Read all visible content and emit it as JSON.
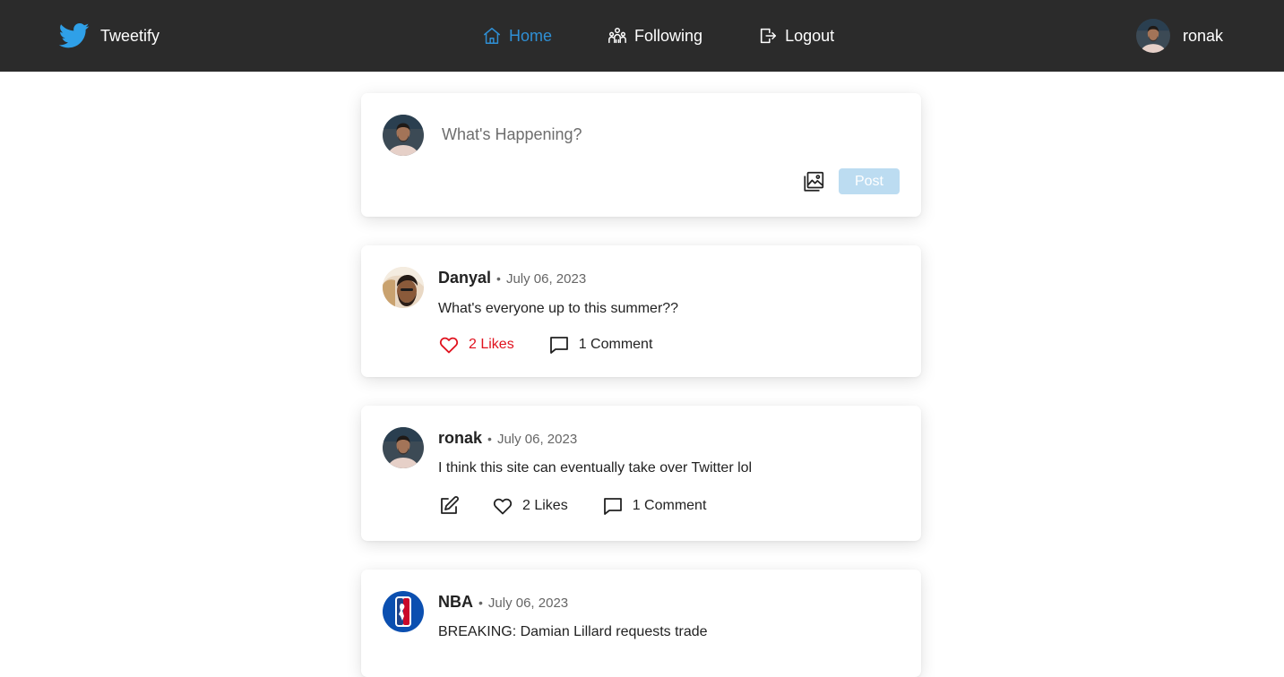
{
  "app": {
    "name": "Tweetify"
  },
  "nav": {
    "links": [
      {
        "label": "Home",
        "icon": "home-icon",
        "active": true
      },
      {
        "label": "Following",
        "icon": "following-icon",
        "active": false
      },
      {
        "label": "Logout",
        "icon": "logout-icon",
        "active": false
      }
    ],
    "user": {
      "name": "ronak"
    }
  },
  "composer": {
    "placeholder": "What's Happening?",
    "post_label": "Post",
    "media_icon": "image-gallery-icon"
  },
  "tweets": [
    {
      "author": "Danyal",
      "date": "July 06, 2023",
      "text": "What's everyone up to this summer??",
      "likes": "2 Likes",
      "comments": "1 Comment",
      "liked": true,
      "editable": false
    },
    {
      "author": "ronak",
      "date": "July 06, 2023",
      "text": "I think this site can eventually take over Twitter lol",
      "likes": "2 Likes",
      "comments": "1 Comment",
      "liked": false,
      "editable": true
    },
    {
      "author": "NBA",
      "date": "July 06, 2023",
      "text": "BREAKING: Damian Lillard requests trade",
      "likes": "",
      "comments": "",
      "liked": false,
      "editable": false
    }
  ],
  "colors": {
    "navbar_bg": "#2b2b2b",
    "active_link": "#2f8fd4",
    "liked": "#e0121e",
    "post_button_disabled": "#bcdcf1",
    "brand_bird": "#2fa0e8"
  }
}
